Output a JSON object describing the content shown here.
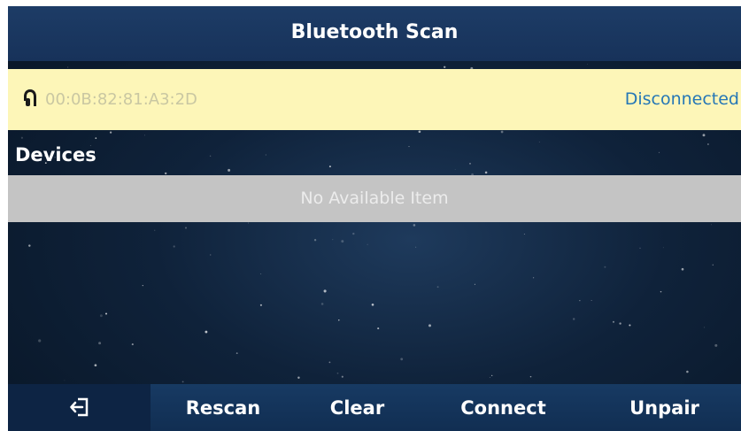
{
  "title": "Bluetooth Scan",
  "paired_device": {
    "icon": "headset-icon",
    "address": "00:0B:82:81:A3:2D",
    "status": "Disconnected",
    "status_color": "#2577b6"
  },
  "devices": {
    "label": "Devices",
    "empty_text": "No Available Item"
  },
  "softkeys": {
    "back_icon": "back-icon",
    "items": [
      "Rescan",
      "Clear",
      "Connect",
      "Unpair"
    ]
  },
  "colors": {
    "title_bar": "#1a3760",
    "paired_row_bg": "#fdf6b8",
    "empty_row_bg": "#c4c4c4",
    "softkey_bar": "#153459"
  }
}
